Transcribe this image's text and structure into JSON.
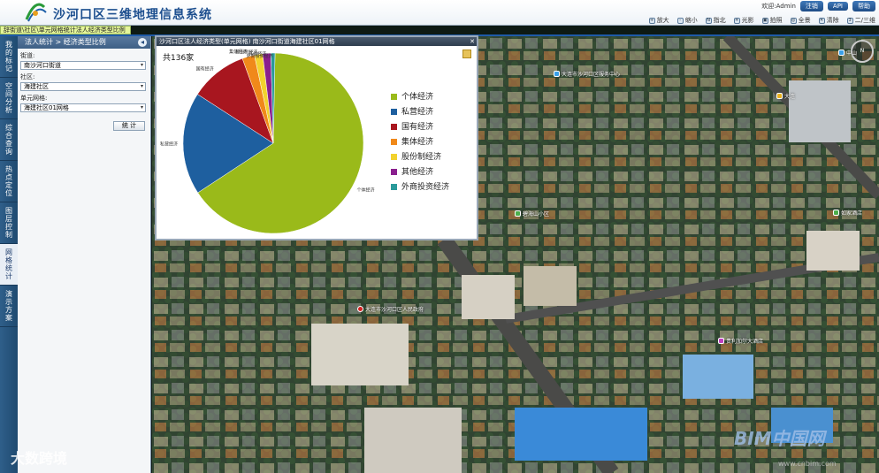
{
  "app": {
    "title": "沙河口区三维地理信息系统"
  },
  "breadcrumb_bar": "辞街道\\社区\\单元网格统计法人经济类型比例",
  "user": {
    "welcome": "欢迎:Admin",
    "logout": "注销",
    "api": "API",
    "help": "帮助"
  },
  "toolbar": [
    "放大",
    "缩小",
    "指北",
    "光影",
    "拍照",
    "全景",
    "清除",
    "二/三维"
  ],
  "side_tabs": [
    "我的标记",
    "空间分析",
    "综合查询",
    "热点定位",
    "图层控制",
    "网格统计",
    "演示方案"
  ],
  "active_tab_index": 5,
  "panel": {
    "title": "法人统计 > 经济类型比例",
    "street_label": "街道:",
    "street_value": "南沙河口街道",
    "community_label": "社区:",
    "community_value": "海建社区",
    "grid_label": "单元网格:",
    "grid_value": "海建社区01网格",
    "stat_button": "统 计"
  },
  "chart_window": {
    "title": "沙河口区法人经济类型(单元网格)    南沙河口街道海建社区01网格",
    "total": "共136家"
  },
  "chart_data": {
    "type": "pie",
    "total_count": 136,
    "slices": [
      {
        "label": "个体经济",
        "value": 89,
        "color": "#9aba1a"
      },
      {
        "label": "私营经济",
        "value": 25,
        "color": "#1e5f9f"
      },
      {
        "label": "国有经济",
        "value": 14,
        "color": "#a8161f"
      },
      {
        "label": "集体经济",
        "value": 3,
        "color": "#f0891a"
      },
      {
        "label": "股份制经济",
        "value": 2,
        "color": "#f2d22e"
      },
      {
        "label": "其他经济",
        "value": 2,
        "color": "#8a1f8e"
      },
      {
        "label": "外商投资经济",
        "value": 1,
        "color": "#2a9a9a"
      }
    ],
    "legend_position": "right"
  },
  "map": {
    "labels": [
      {
        "text": "大连市沙河口区服务中心",
        "pin": "blue"
      },
      {
        "text": "大连",
        "pin": "yellow"
      },
      {
        "text": "中山",
        "pin": "blue"
      },
      {
        "text": "碧海山小区",
        "pin": "green"
      },
      {
        "text": "如家酒店",
        "pin": "green"
      },
      {
        "text": "大连市沙河口区人民政府",
        "pin": "red"
      },
      {
        "text": "贵利加尔大酒店",
        "pin": "purple"
      }
    ]
  },
  "watermarks": {
    "left": "大数跨境",
    "right": "BIM中国网",
    "right_url": "www.cnbim.com"
  }
}
